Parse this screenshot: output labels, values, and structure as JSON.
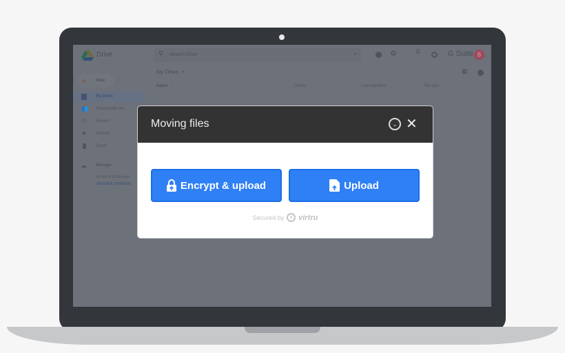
{
  "drive": {
    "app_name": "Drive",
    "search_placeholder": "Search Drive",
    "brand": "G Suite",
    "avatar_initial": "B",
    "new_label": "New",
    "sidebar": [
      {
        "label": "My Drive"
      },
      {
        "label": "Shared with me"
      },
      {
        "label": "Recent"
      },
      {
        "label": "Starred"
      },
      {
        "label": "Trash"
      }
    ],
    "storage_label": "Storage",
    "storage_usage": "9.6 MB of 30 GB used",
    "upgrade_label": "UPGRADE STORAGE",
    "breadcrumb": "My Drive",
    "columns": {
      "name": "Name",
      "owner": "Owner",
      "modified": "Last modified",
      "size": "File size"
    }
  },
  "dialog": {
    "title": "Moving files",
    "encrypt_label": "Encrypt & upload",
    "upload_label": "Upload",
    "secured_by": "Secured by",
    "brand": "virtru"
  },
  "colors": {
    "button": "#2f80f5",
    "header": "#333333",
    "avatar": "#a0485e"
  }
}
